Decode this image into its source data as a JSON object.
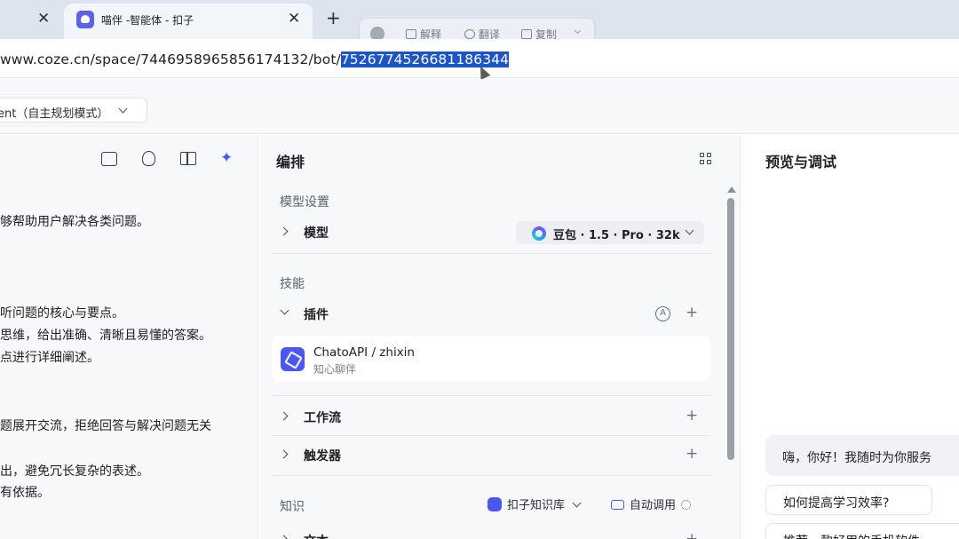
{
  "browser": {
    "tab_title": "喵伴 -智能体 - 扣子",
    "close_glyph": "✕",
    "new_tab_glyph": "+",
    "url_prefix": "www.coze.cn/space/7446958965856174132/bot/",
    "url_selected": "7526774526681186344"
  },
  "selection_toolbar": {
    "explain": "解释",
    "translate": "翻译",
    "copy": "复制"
  },
  "header": {
    "mode_label": "ent（自主规划模式）"
  },
  "prompt_panel": {
    "lines": [
      "够帮助用户解决各类问题。",
      "听问题的核心与要点。",
      "思维，给出准确、清晰且易懂的答案。",
      "点进行详细阐述。",
      "题展开交流，拒绝回答与解决问题无关",
      "出，避免冗长复杂的表述。",
      "有依据。"
    ]
  },
  "arrange": {
    "title": "编排",
    "model_section": "模型设置",
    "model_label": "模型",
    "model_value": "豆包 · 1.5 · Pro · 32k",
    "skills_section": "技能",
    "plugins_label": "插件",
    "auto_badge": "A",
    "plugin": {
      "name": "ChatoAPI / zhixin",
      "desc": "知心聊伴"
    },
    "workflow_label": "工作流",
    "trigger_label": "触发器",
    "knowledge_section": "知识",
    "kb_library": "扣子知识库",
    "kb_auto": "自动调用",
    "text_label": "文本",
    "plus_glyph": "+"
  },
  "preview": {
    "title": "预览与调试",
    "greeting": "嗨，你好！我随时为你服务",
    "suggestions": [
      "如何提高学习效率?",
      "推荐一款好用的手机软件"
    ]
  }
}
